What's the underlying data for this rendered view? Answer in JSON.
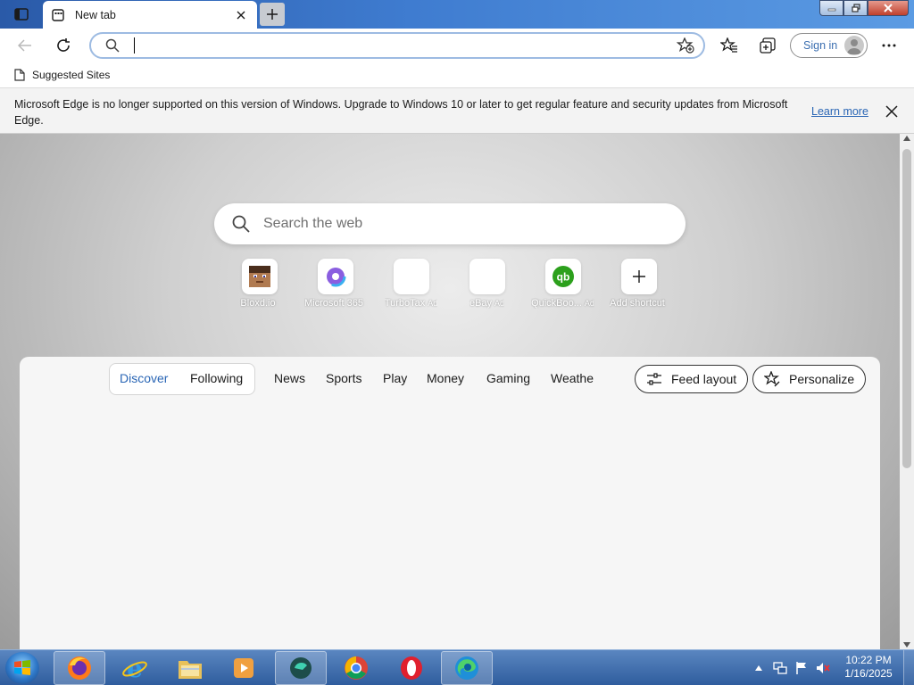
{
  "browser": {
    "tab_title": "New tab",
    "address_value": "",
    "signin_label": "Sign in"
  },
  "favorites_bar": {
    "item_label": "Suggested Sites"
  },
  "infobar": {
    "message": "Microsoft Edge is no longer supported on this version of Windows. Upgrade to Windows 10 or later to get regular feature and security updates from Microsoft Edge.",
    "link_label": "Learn more"
  },
  "newtab": {
    "search_placeholder": "Search the web",
    "shortcuts": [
      {
        "label": "Bloxd.io",
        "ad": ""
      },
      {
        "label": "Microsoft 365",
        "ad": ""
      },
      {
        "label": "TurboTax",
        "ad": "Ad"
      },
      {
        "label": "eBay",
        "ad": "Ad"
      },
      {
        "label": "QuickBoo...",
        "ad": "Ad"
      },
      {
        "label": "Add shortcut",
        "ad": ""
      }
    ],
    "feed_tabs": [
      "Discover",
      "Following",
      "News",
      "Sports",
      "Play",
      "Money",
      "Gaming",
      "Weathe"
    ],
    "feed_layout_label": "Feed layout",
    "personalize_label": "Personalize"
  },
  "taskbar": {
    "apps": [
      "firefox-icon",
      "internet-explorer-icon",
      "file-explorer-icon",
      "media-player-icon",
      "app-icon",
      "chrome-icon",
      "opera-icon",
      "edge-icon"
    ],
    "time": "10:22 PM",
    "date": "1/16/2025"
  },
  "colors": {
    "accent": "#2a66b5",
    "titlebar": "#3f7cd0",
    "infobar": "#f3f3f3"
  }
}
